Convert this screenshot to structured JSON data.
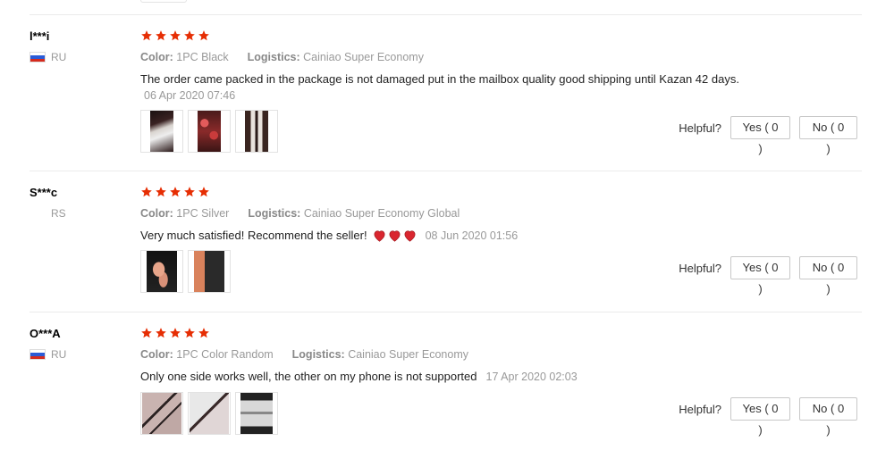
{
  "colors": {
    "star": "#e62e04",
    "heart": "#d9262f",
    "divider": "#ebebeb"
  },
  "reviews": [
    {
      "user": "l***i",
      "country": "RU",
      "flag": "ru",
      "rating": 5,
      "color_label": "Color:",
      "color_value": "1PC Black",
      "logistics_label": "Logistics:",
      "logistics_value": "Cainiao Super Economy",
      "text": "The order came packed in the package is not damaged put in the mailbox quality good shipping until Kazan 42 days.",
      "date": "06 Apr 2020 07:46",
      "helpful_label": "Helpful?",
      "yes_label": "Yes ( 0 )",
      "no_label": "No ( 0 )",
      "photos": [
        "phone-case-photo",
        "phone-case-photo",
        "phone-case-photo"
      ]
    },
    {
      "user": "S***c",
      "country": "RS",
      "flag": "",
      "rating": 5,
      "color_label": "Color:",
      "color_value": "1PC Silver",
      "logistics_label": "Logistics:",
      "logistics_value": "Cainiao Super Economy Global",
      "text": "Very much satisfied! Recommend the seller!",
      "emoji": [
        "heart",
        "heart",
        "heart"
      ],
      "date": "08 Jun 2020 01:56",
      "helpful_label": "Helpful?",
      "yes_label": "Yes ( 0 )",
      "no_label": "No ( 0 )",
      "photos": [
        "hand-holding-stylus-photo",
        "hand-holding-stylus-photo"
      ]
    },
    {
      "user": "O***A",
      "country": "RU",
      "flag": "ru",
      "rating": 5,
      "color_label": "Color:",
      "color_value": "1PC Color Random",
      "logistics_label": "Logistics:",
      "logistics_value": "Cainiao Super Economy",
      "text": "Only one side works well, the other on my phone is not supported",
      "date": "17 Apr 2020 02:03",
      "helpful_label": "Helpful?",
      "yes_label": "Yes ( 0 )",
      "no_label": "No ( 0 )",
      "photos": [
        "stylus-pen-photo",
        "stylus-pen-photo",
        "stylus-package-photo"
      ]
    }
  ]
}
